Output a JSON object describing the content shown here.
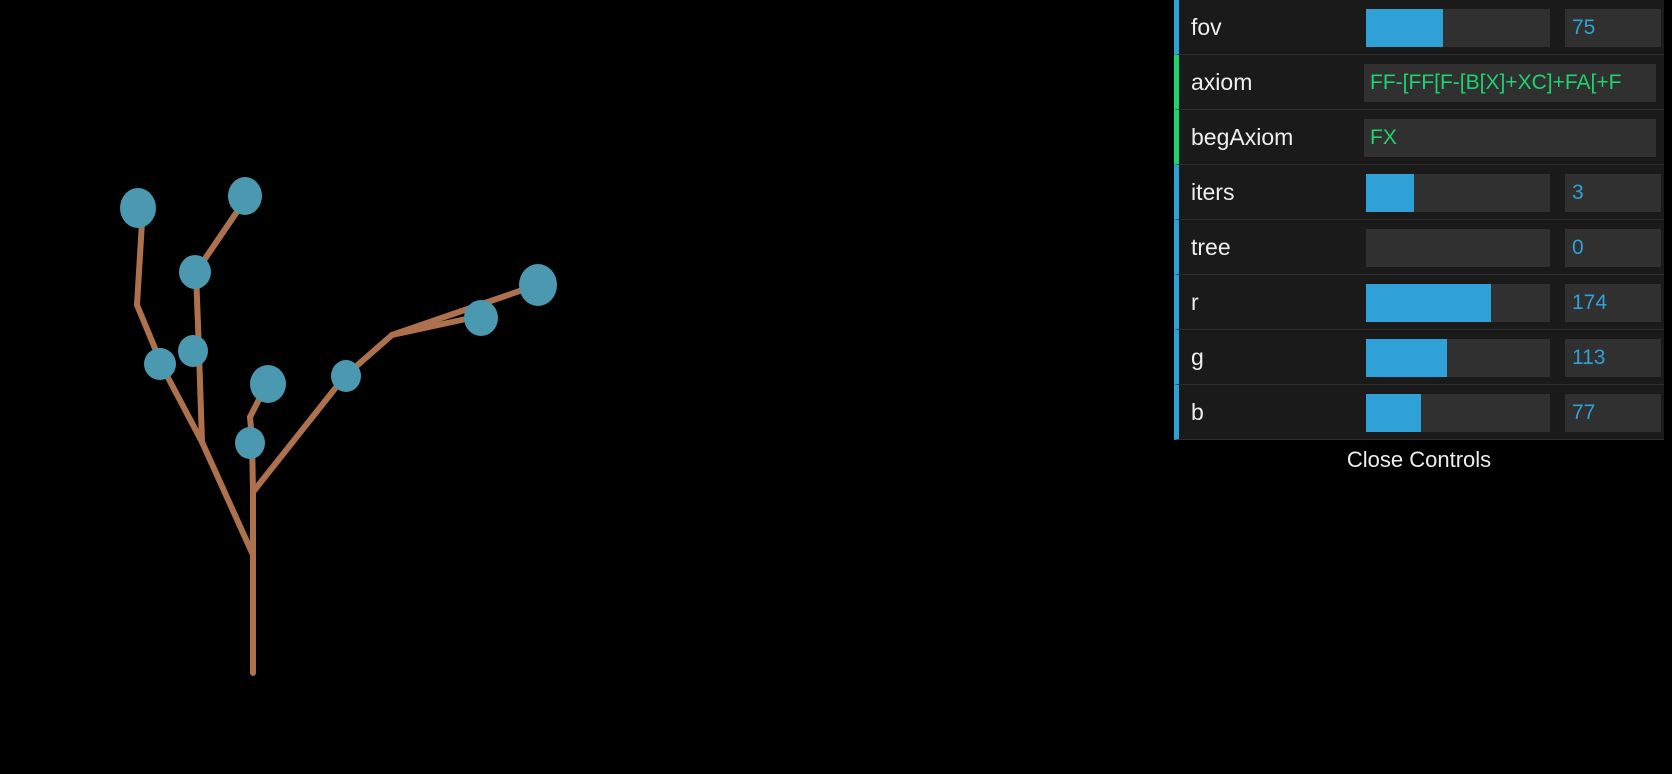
{
  "scene": {
    "branch_color": "#ae714d",
    "leaf_color": "#4a99b1",
    "background": "#000000"
  },
  "controls": [
    {
      "key": "fov",
      "label": "fov",
      "type": "number",
      "value": "75",
      "fill": 0.42
    },
    {
      "key": "axiom",
      "label": "axiom",
      "type": "string",
      "value": "FF-[FF[F-[B[X]+XC]+FA[+F"
    },
    {
      "key": "begAxiom",
      "label": "begAxiom",
      "type": "string",
      "value": "FX"
    },
    {
      "key": "iters",
      "label": "iters",
      "type": "number",
      "value": "3",
      "fill": 0.26
    },
    {
      "key": "tree",
      "label": "tree",
      "type": "number",
      "value": "0",
      "fill": 0.0
    },
    {
      "key": "r",
      "label": "r",
      "type": "number",
      "value": "174",
      "fill": 0.68
    },
    {
      "key": "g",
      "label": "g",
      "type": "number",
      "value": "113",
      "fill": 0.44
    },
    {
      "key": "b",
      "label": "b",
      "type": "number",
      "value": "77",
      "fill": 0.3
    }
  ],
  "close_label": "Close Controls"
}
